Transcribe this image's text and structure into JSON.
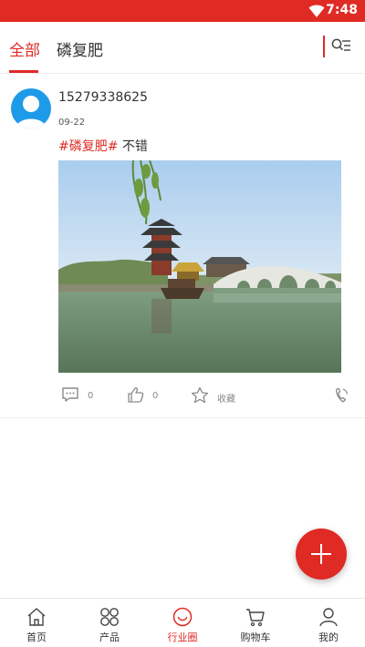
{
  "status_bar": {
    "time": "7:48",
    "icon": "wifi-icon"
  },
  "tabs": [
    {
      "label": "全部",
      "active": true
    },
    {
      "label": "磷复肥",
      "active": false
    }
  ],
  "filter": {
    "icon": "filter-search-icon"
  },
  "post": {
    "username": "15279338625",
    "date": "09-22",
    "hashtag": "#磷复肥#",
    "text": "不错",
    "image_icon": "landscape-photo",
    "comment_count": "0",
    "like_count": "0",
    "favorite_label": "收藏"
  },
  "fab": {
    "icon": "plus-icon"
  },
  "bottom_nav": [
    {
      "label": "首页",
      "icon": "home-icon",
      "active": false
    },
    {
      "label": "产品",
      "icon": "grid-icon",
      "active": false
    },
    {
      "label": "行业圈",
      "icon": "circle-smile-icon",
      "active": true
    },
    {
      "label": "购物车",
      "icon": "cart-icon",
      "active": false
    },
    {
      "label": "我的",
      "icon": "user-icon",
      "active": false
    }
  ],
  "colors": {
    "accent": "#e02a24",
    "avatar": "#1e9be8"
  }
}
